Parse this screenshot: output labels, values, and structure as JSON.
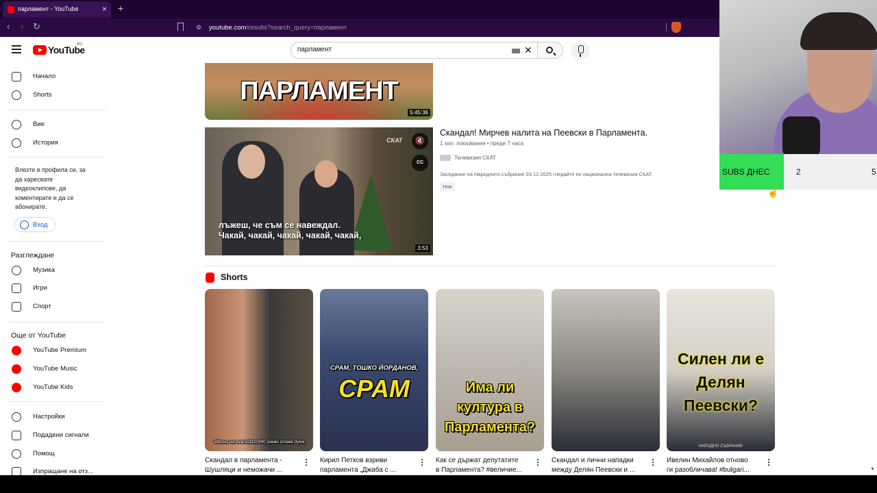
{
  "browser": {
    "tab_title": "парламент - YouTube",
    "url_host": "youtube.com",
    "url_path": "/results?search_query=парламент"
  },
  "masthead": {
    "logo_text": "YouTube",
    "country_code": "BG",
    "search_value": "парламент"
  },
  "sidebar": {
    "home": "Начало",
    "shorts": "Shorts",
    "you": "Вие",
    "history": "История",
    "signin_prompt": "Влезте в профила си, за да харесвате видеоклипове, да коментирате и да се абонирате.",
    "signin_button": "Вход",
    "explore_header": "Разглеждане",
    "music": "Музика",
    "gaming": "Игри",
    "sports": "Спорт",
    "more_header": "Още от YouTube",
    "premium": "YouTube Premium",
    "yt_music": "YouTube Music",
    "yt_kids": "YouTube Kids",
    "settings": "Настройки",
    "report_history": "Подадени сигнали",
    "help": "Помощ",
    "feedback": "Изпращане на отз..."
  },
  "results": {
    "video1": {
      "thumb_text": "ПАРЛАМЕНТ",
      "duration": "5:45:36"
    },
    "video2": {
      "title": "Скандал! Мирчев налита на Пеевски в Парламента.",
      "views": "1 хил. показвания",
      "age": "преди 7 часа",
      "channel": "Телевизия СКАТ",
      "description": "Заседание на Народното събрание 03.12.2025 гледайте по национална телевизия СКАТ.",
      "badge": "Нов",
      "duration": "3:53",
      "caption_line1": "лъжеш, че съм се навеждал.",
      "caption_line2": "Чакай, чакай, чакай, чакай, чакай,",
      "watermark": "СКАТ",
      "cc_label": "CC"
    }
  },
  "shorts": {
    "header": "Shorts",
    "items": [
      {
        "thumb_text": "обясни на тоя ШУШЛЯК, какво става дума",
        "title_line1": "Скандал в парламента -",
        "title_line2": "Шушляци и неможачи ..."
      },
      {
        "thumb_text_small": "СРАМ, ТОШКО ЙОРДАНОВ,",
        "thumb_text_big": "СРАМ",
        "title_line1": "Кирил Петков взриви",
        "title_line2": "парламента „Джаба с ..."
      },
      {
        "thumb_text": "Има ли култура в Парламента?",
        "title_line1": "Как се държат депутатите",
        "title_line2": "в Парламента? #величие..."
      },
      {
        "title_line1": "Скандал и лични нападки",
        "title_line2": "между Делян Пеевски и ..."
      },
      {
        "thumb_text": "Силен ли е Делян Пеевски?",
        "thumb_footer": "НАРОДНО СЪБРАНИЕ",
        "title_line1": "Ивелин Михайлов отново",
        "title_line2": "ги разобличава! #bulgari..."
      }
    ]
  },
  "overlay": {
    "subs_label": "SUBS ДНЕС",
    "subs_value": "2",
    "subs_goal": "5"
  },
  "colors": {
    "youtube_red": "#ff0000",
    "link_blue": "#065fd4",
    "subs_green": "#33dd55"
  }
}
